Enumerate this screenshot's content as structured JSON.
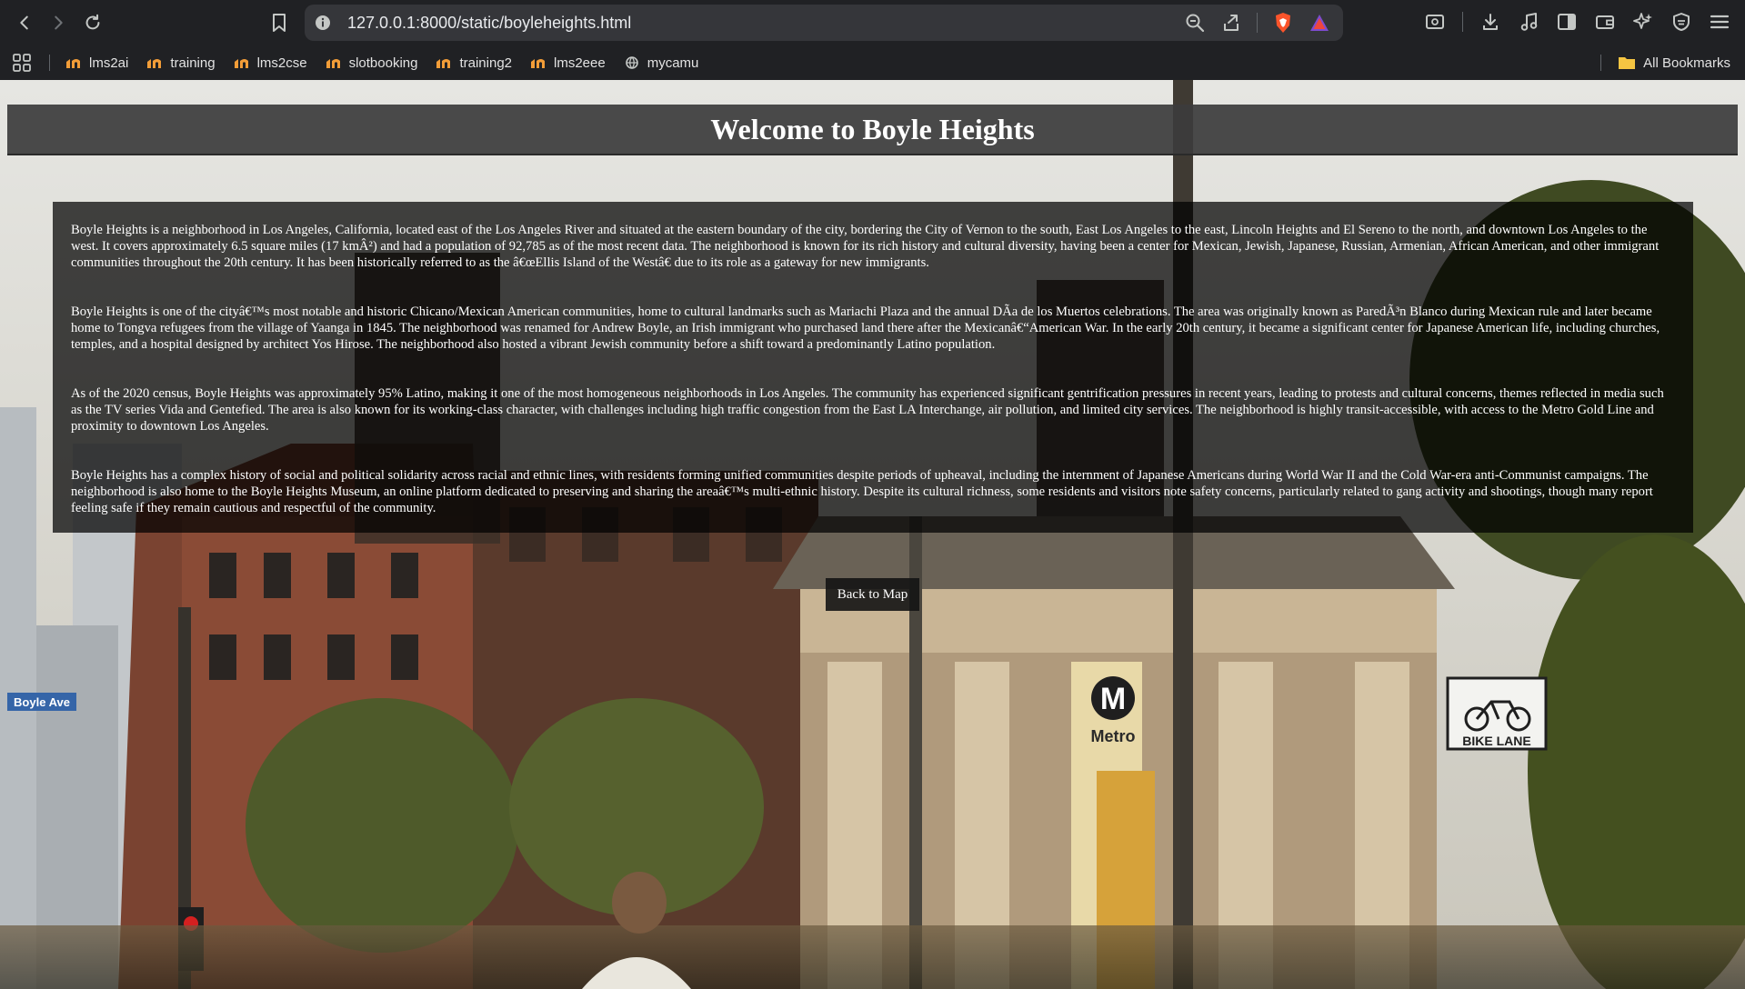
{
  "browser": {
    "url": "127.0.0.1:8000/static/boyleheights.html",
    "bookmarks": [
      {
        "label": "lms2ai"
      },
      {
        "label": "training"
      },
      {
        "label": "lms2cse"
      },
      {
        "label": "slotbooking"
      },
      {
        "label": "training2"
      },
      {
        "label": "lms2eee"
      },
      {
        "label": "mycamu"
      }
    ],
    "all_bookmarks": "All Bookmarks",
    "accent_colors": {
      "favicon": "#f29d38",
      "brave": "#fb542b",
      "folder": "#f5c542"
    }
  },
  "page": {
    "title": "Welcome to Boyle Heights",
    "paragraphs": [
      "Boyle Heights is a neighborhood in Los Angeles, California, located east of the Los Angeles River and situated at the eastern boundary of the city, bordering the City of Vernon to the south, East Los Angeles to the east, Lincoln Heights and El Sereno to the north, and downtown Los Angeles to the west. It covers approximately 6.5 square miles (17 kmÂ²) and had a population of 92,785 as of the most recent data. The neighborhood is known for its rich history and cultural diversity, having been a center for Mexican, Jewish, Japanese, Russian, Armenian, African American, and other immigrant communities throughout the 20th century. It has been historically referred to as the â€œEllis Island of the Westâ€ due to its role as a gateway for new immigrants.",
      "Boyle Heights is one of the cityâ€™s most notable and historic Chicano/Mexican American communities, home to cultural landmarks such as Mariachi Plaza and the annual DÃa de los Muertos celebrations. The area was originally known as ParedÃ³n Blanco during Mexican rule and later became home to Tongva refugees from the village of Yaanga in 1845. The neighborhood was renamed for Andrew Boyle, an Irish immigrant who purchased land there after the Mexicanâ€“American War. In the early 20th century, it became a significant center for Japanese American life, including churches, temples, and a hospital designed by architect Yos Hirose. The neighborhood also hosted a vibrant Jewish community before a shift toward a predominantly Latino population.",
      "As of the 2020 census, Boyle Heights was approximately 95% Latino, making it one of the most homogeneous neighborhoods in Los Angeles. The community has experienced significant gentrification pressures in recent years, leading to protests and cultural concerns, themes reflected in media such as the TV series Vida and Gentefied. The area is also known for its working-class character, with challenges including high traffic congestion from the East LA Interchange, air pollution, and limited city services. The neighborhood is highly transit-accessible, with access to the Metro Gold Line and proximity to downtown Los Angeles.",
      "Boyle Heights has a complex history of social and political solidarity across racial and ethnic lines, with residents forming unified communities despite periods of upheaval, including the internment of Japanese Americans during World War II and the Cold War-era anti-Communist campaigns. The neighborhood is also home to the Boyle Heights Museum, an online platform dedicated to preserving and sharing the areaâ€™s multi-ethnic history. Despite its cultural richness, some residents and visitors note safety concerns, particularly related to gang activity and shootings, though many report feeling safe if they remain cautious and respectful of the community."
    ],
    "back_button": "Back to Map",
    "background_scene": {
      "metro_sign": "Metro",
      "metro_letter": "M",
      "bike_sign": "BIKE LANE",
      "street_sign": "Boyle Ave"
    }
  }
}
